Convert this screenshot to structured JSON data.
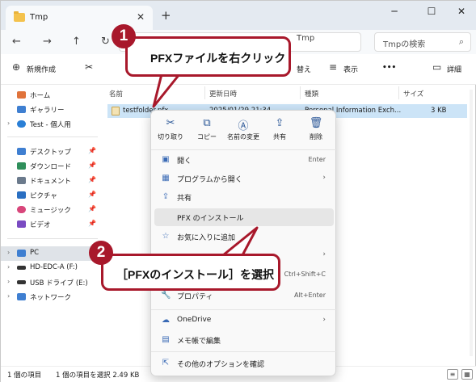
{
  "window": {
    "tab_title": "Tmp",
    "tab_close": "✕",
    "tab_add": "+",
    "min": "─",
    "max": "☐",
    "close": "✕"
  },
  "address": {
    "back": "←",
    "forward": "→",
    "up": "↑",
    "refresh": "↻",
    "path": "Tmp",
    "search_placeholder": "Tmpの検索",
    "search_icon": "⌕"
  },
  "toolbar": {
    "new_label": "新規作成",
    "new_icon": "⊕",
    "cut_icon": "✂",
    "sort_label": "替え",
    "view_label": "表示",
    "view_icon": "≡",
    "more_label": "•••",
    "details_label": "詳細",
    "details_icon": "▭"
  },
  "sidebar": {
    "items": [
      {
        "label": "ホーム",
        "icon": "home-icon",
        "color": "#e0733b"
      },
      {
        "label": "ギャラリー",
        "icon": "gallery-icon",
        "color": "#3f7fd1"
      },
      {
        "label": "Test - 個人用",
        "icon": "cloud-icon",
        "color": "#2a7fd6"
      },
      {
        "label": "デスクトップ",
        "icon": "desktop-icon",
        "color": "#3f7fd1"
      },
      {
        "label": "ダウンロード",
        "icon": "download-icon",
        "color": "#2f8f5b"
      },
      {
        "label": "ドキュメント",
        "icon": "document-icon",
        "color": "#6b7a8c"
      },
      {
        "label": "ピクチャ",
        "icon": "pictures-icon",
        "color": "#2a6fc2"
      },
      {
        "label": "ミュージック",
        "icon": "music-icon",
        "color": "#d8467b"
      },
      {
        "label": "ビデオ",
        "icon": "video-icon",
        "color": "#7a4bc2"
      },
      {
        "label": "PC",
        "icon": "pc-icon",
        "color": "#3f7fd1"
      },
      {
        "label": "HD-EDC-A (F:)",
        "icon": "drive-icon",
        "color": "#333333"
      },
      {
        "label": "USB ドライブ (E:)",
        "icon": "usb-drive-icon",
        "color": "#333333"
      },
      {
        "label": "ネットワーク",
        "icon": "network-icon",
        "color": "#3f7fd1"
      }
    ]
  },
  "filelist": {
    "headers": [
      "名前",
      "更新日時",
      "種類",
      "サイズ"
    ],
    "rows": [
      {
        "name": "testfolder.pfx",
        "date": "2025/01/29 21:34",
        "type": "Personal Information Exch...",
        "size": "3 KB"
      }
    ]
  },
  "status": {
    "count": "1 個の項目",
    "selected": "1 個の項目を選択  2.49 KB"
  },
  "context_menu": {
    "top_actions": [
      {
        "label": "切り取り",
        "icon": "scissors-icon",
        "glyph": "✂"
      },
      {
        "label": "コピー",
        "icon": "copy-icon",
        "glyph": "⧉"
      },
      {
        "label": "名前の変更",
        "icon": "rename-icon",
        "glyph": "Ⓐ"
      },
      {
        "label": "共有",
        "icon": "share-icon",
        "glyph": "⇪"
      },
      {
        "label": "削除",
        "icon": "trash-icon",
        "glyph": "🗑"
      }
    ],
    "items": [
      {
        "label": "開く",
        "shortcut": "Enter",
        "glyph": "▣"
      },
      {
        "label": "プログラムから開く",
        "arrow": "›",
        "glyph": "▦"
      },
      {
        "label": "共有",
        "glyph": "⇪"
      },
      {
        "label": "PFX のインストール",
        "glyph": ""
      },
      {
        "label": "お気に入りに追加",
        "glyph": "☆"
      },
      {
        "label": "",
        "arrow": "›",
        "glyph": ""
      },
      {
        "label": "",
        "shortcut": "Ctrl+Shift+C",
        "glyph": ""
      },
      {
        "label": "プロパティ",
        "shortcut": "Alt+Enter",
        "glyph": "🔧"
      },
      {
        "label": "OneDrive",
        "arrow": "›",
        "glyph": "☁"
      },
      {
        "label": "メモ帳で編集",
        "glyph": "▤"
      },
      {
        "label": "その他のオプションを確認",
        "glyph": "⇱"
      }
    ]
  },
  "callouts": {
    "step1_number": "1",
    "step1_text": "PFXファイルを右クリック",
    "step2_number": "2",
    "step2_text": "［PFXのインストール］を選択",
    "accent_color": "#a8182b"
  }
}
